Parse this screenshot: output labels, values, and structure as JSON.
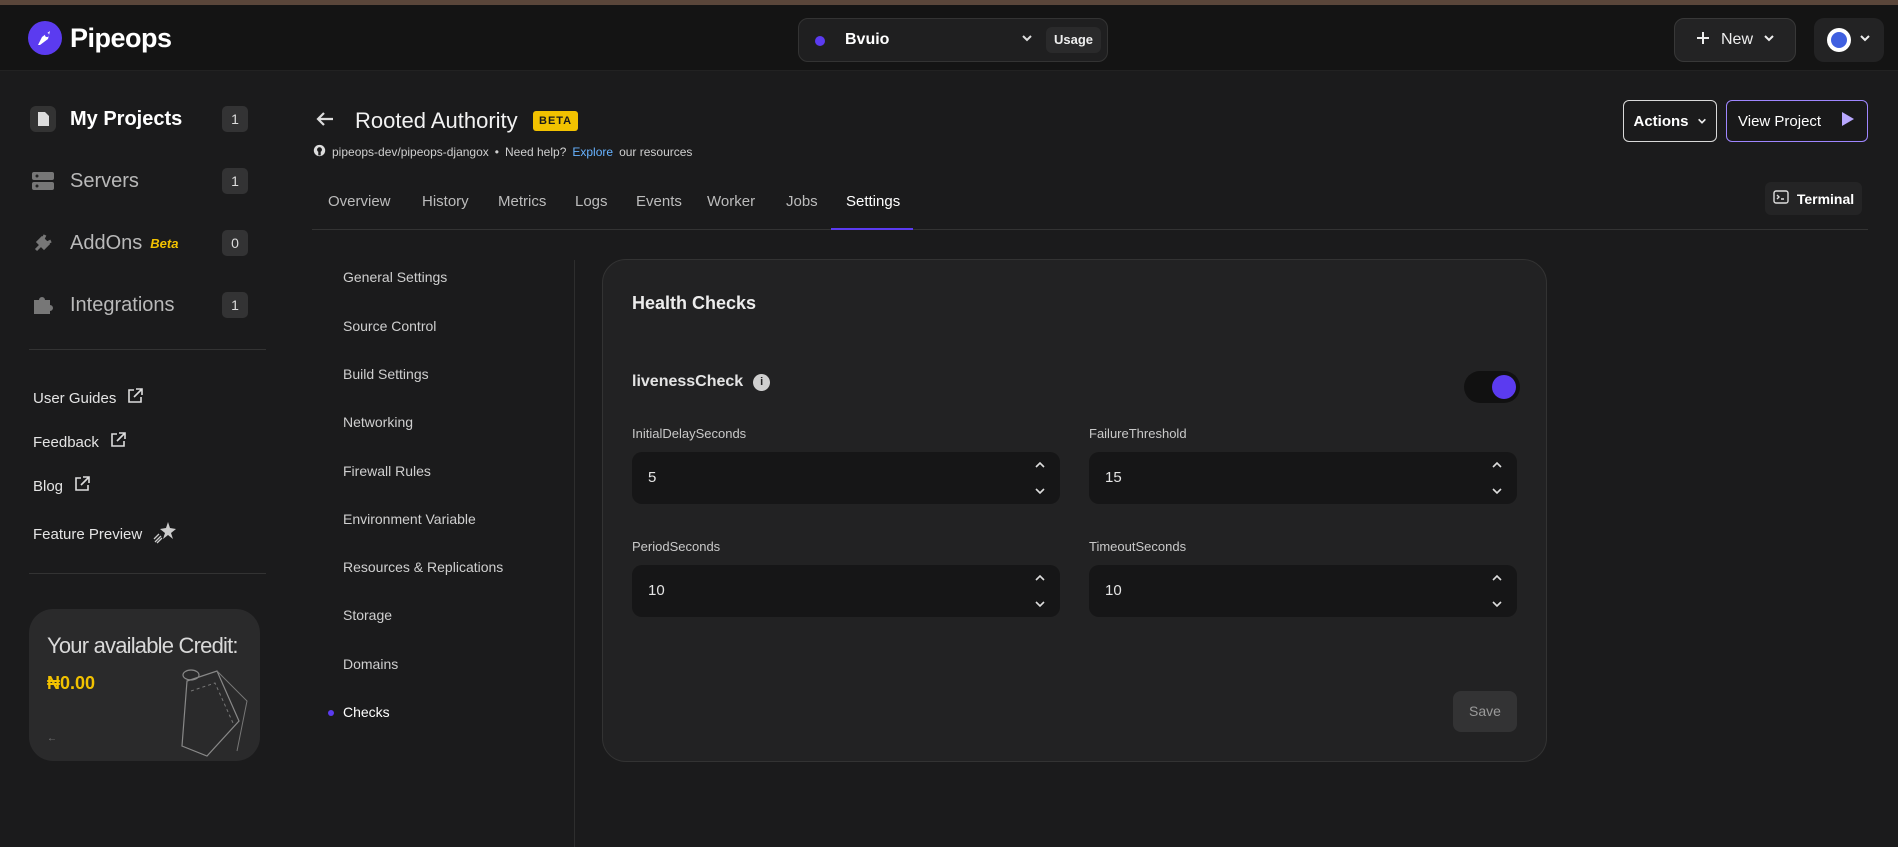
{
  "brand": {
    "name": "Pipeops"
  },
  "topbar": {
    "project_name": "Bvuio",
    "usage_label": "Usage",
    "new_label": "New"
  },
  "sidebar": {
    "items": [
      {
        "label": "My Projects",
        "count": "1",
        "icon": "document-icon"
      },
      {
        "label": "Servers",
        "count": "1",
        "icon": "server-icon"
      },
      {
        "label": "AddOns",
        "tag": "Beta",
        "count": "0",
        "icon": "plug-icon"
      },
      {
        "label": "Integrations",
        "count": "1",
        "icon": "puzzle-icon"
      }
    ],
    "links": [
      {
        "label": "User Guides",
        "icon": "external-link-icon"
      },
      {
        "label": "Feedback",
        "icon": "external-link-icon"
      },
      {
        "label": "Blog",
        "icon": "external-link-icon"
      },
      {
        "label": "Feature Preview",
        "icon": "sparkle-icon"
      }
    ],
    "credit": {
      "title": "Your available Credit:",
      "value": "₦0.00",
      "arrow": "←"
    }
  },
  "header": {
    "title": "Rooted Authority",
    "badge": "BETA",
    "repo": "pipeops-dev/pipeops-djangox",
    "help_prefix": "Need help?",
    "help_link": "Explore",
    "help_suffix": "our resources",
    "actions_label": "Actions",
    "view_project_label": "View Project",
    "terminal_label": "Terminal"
  },
  "tabs": [
    "Overview",
    "History",
    "Metrics",
    "Logs",
    "Events",
    "Worker",
    "Jobs",
    "Settings"
  ],
  "settings_menu": [
    "General Settings",
    "Source Control",
    "Build Settings",
    "Networking",
    "Firewall Rules",
    "Environment Variable",
    "Resources & Replications",
    "Storage",
    "Domains",
    "Checks"
  ],
  "panel": {
    "title": "Health Checks",
    "liveness_label": "livenessCheck",
    "info": "i",
    "fields": [
      {
        "label": "InitialDelaySeconds",
        "value": "5"
      },
      {
        "label": "FailureThreshold",
        "value": "15"
      },
      {
        "label": "PeriodSeconds",
        "value": "10"
      },
      {
        "label": "TimeoutSeconds",
        "value": "10"
      }
    ],
    "save_label": "Save"
  },
  "colors": {
    "accent": "#5b3bf0",
    "beta_yellow": "#f2c200",
    "link_blue": "#67b2ff"
  }
}
